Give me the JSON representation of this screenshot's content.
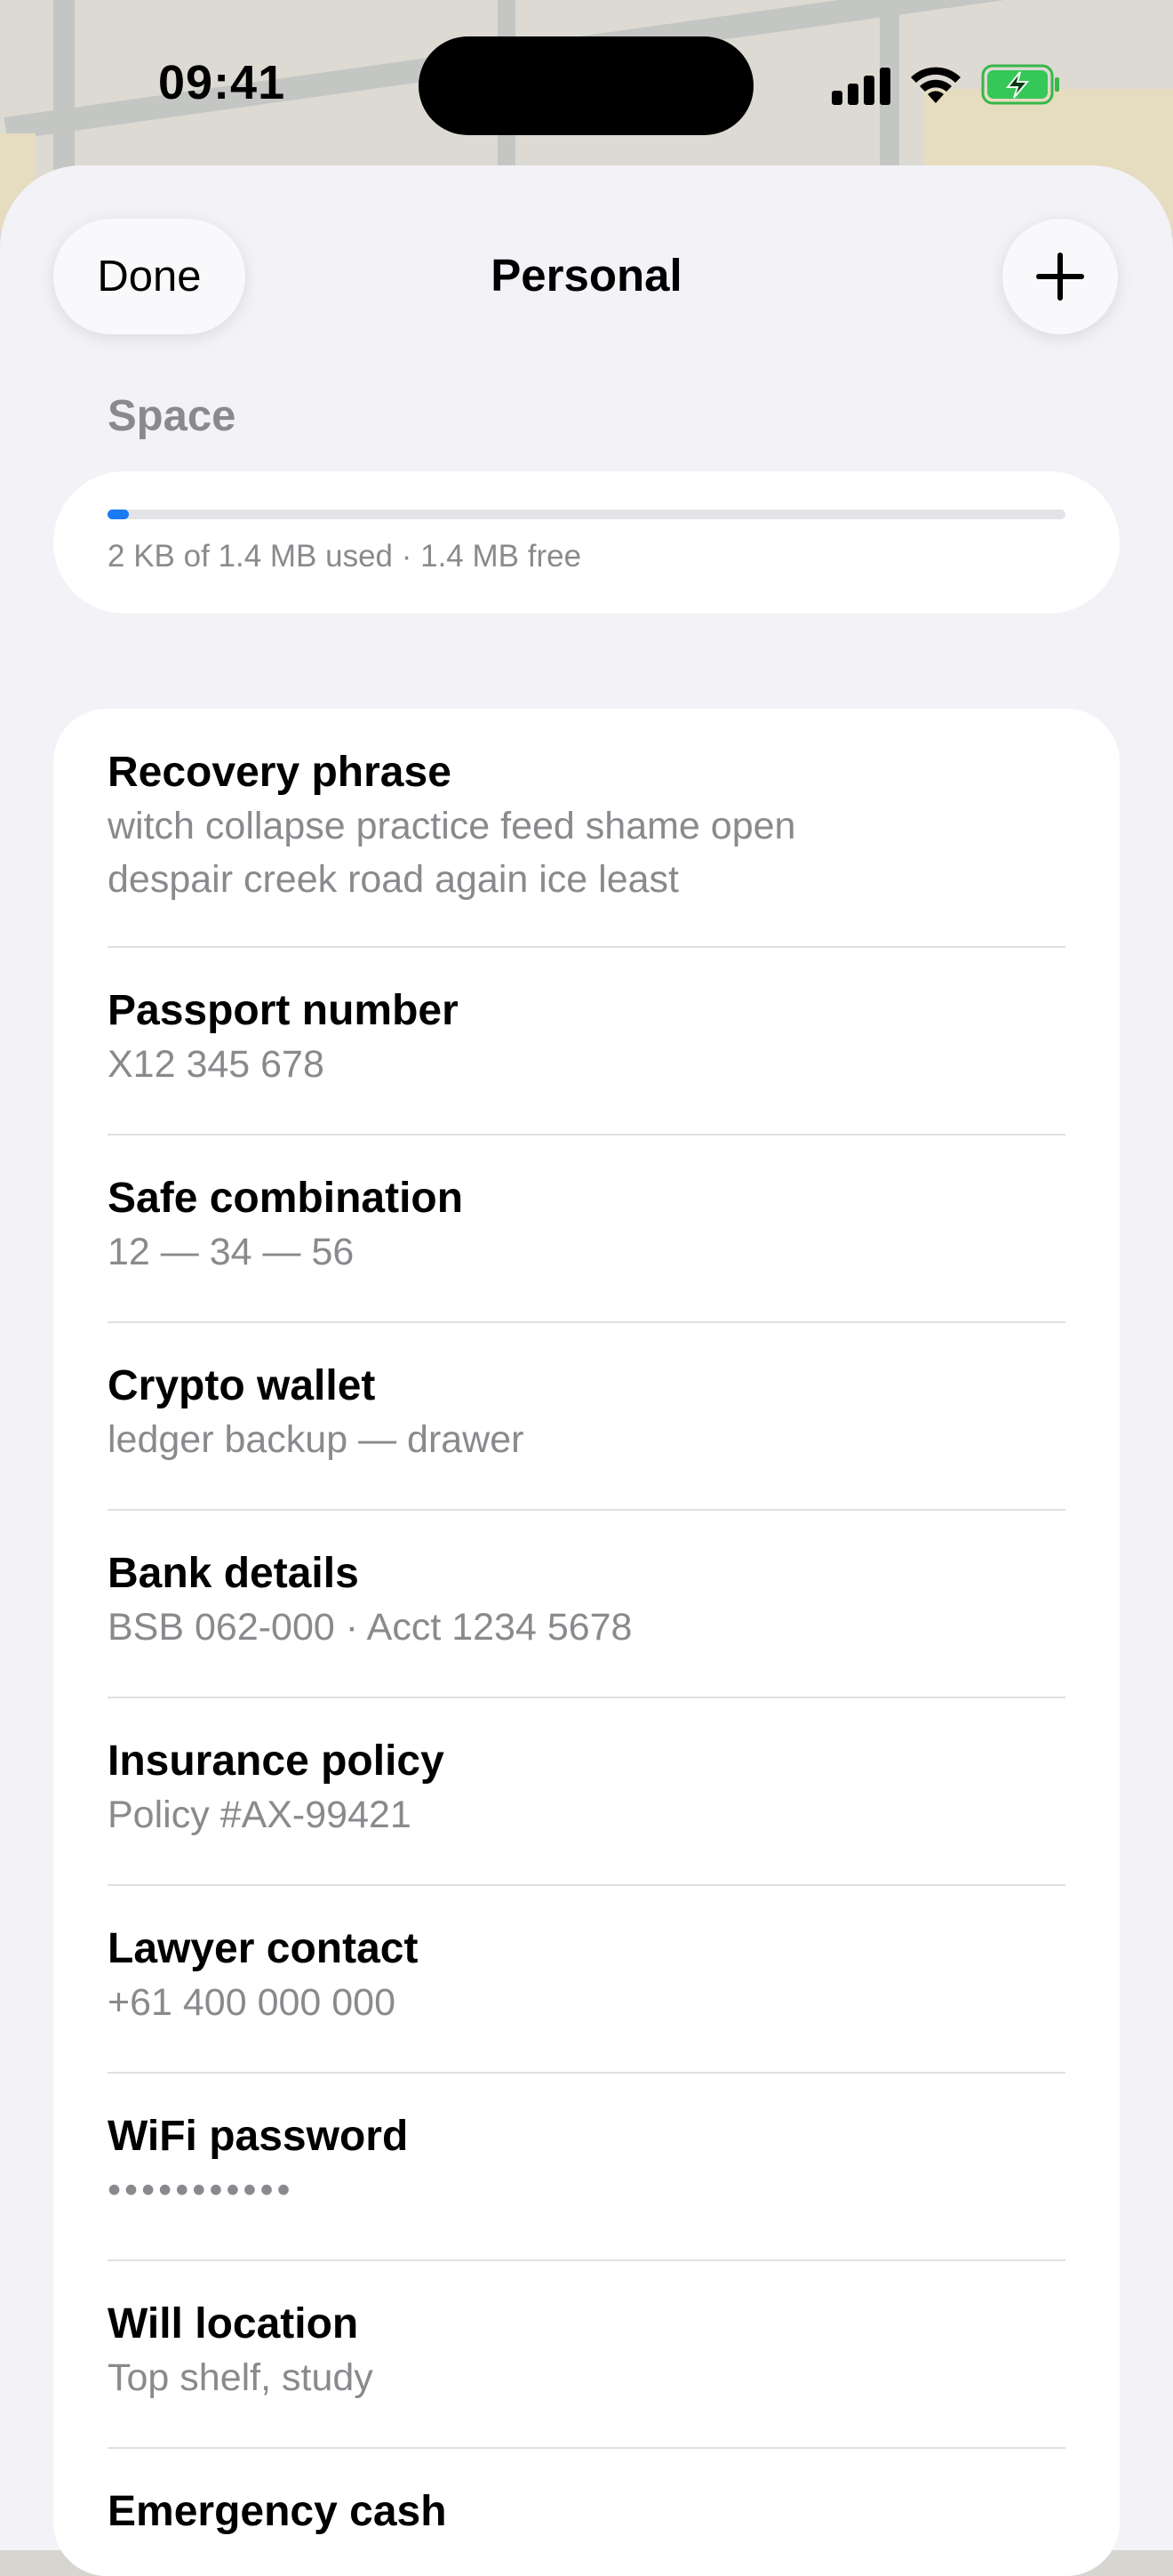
{
  "status_bar": {
    "time": "09:41"
  },
  "header": {
    "done_label": "Done",
    "title": "Personal",
    "add_icon": "plus-icon"
  },
  "space": {
    "section_label": "Space",
    "usage_text": "2 KB of 1.4 MB used · 1.4 MB free",
    "used_fraction": 0.0014,
    "accent_color": "#1a7cf2"
  },
  "items": [
    {
      "title": "Recovery phrase",
      "subtitle": "witch collapse practice feed shame open despair creek road again ice least"
    },
    {
      "title": "Passport number",
      "subtitle": "X12 345 678"
    },
    {
      "title": "Safe combination",
      "subtitle": "12 — 34 — 56"
    },
    {
      "title": "Crypto wallet",
      "subtitle": "ledger backup — drawer"
    },
    {
      "title": "Bank details",
      "subtitle": "BSB 062-000 · Acct 1234 5678"
    },
    {
      "title": "Insurance policy",
      "subtitle": "Policy #AX-99421"
    },
    {
      "title": "Lawyer contact",
      "subtitle": "+61 400 000 000"
    },
    {
      "title": "WiFi password",
      "subtitle": "•••••••••••"
    },
    {
      "title": "Will location",
      "subtitle": "Top shelf, study"
    },
    {
      "title": "Emergency cash",
      "subtitle": ""
    }
  ]
}
